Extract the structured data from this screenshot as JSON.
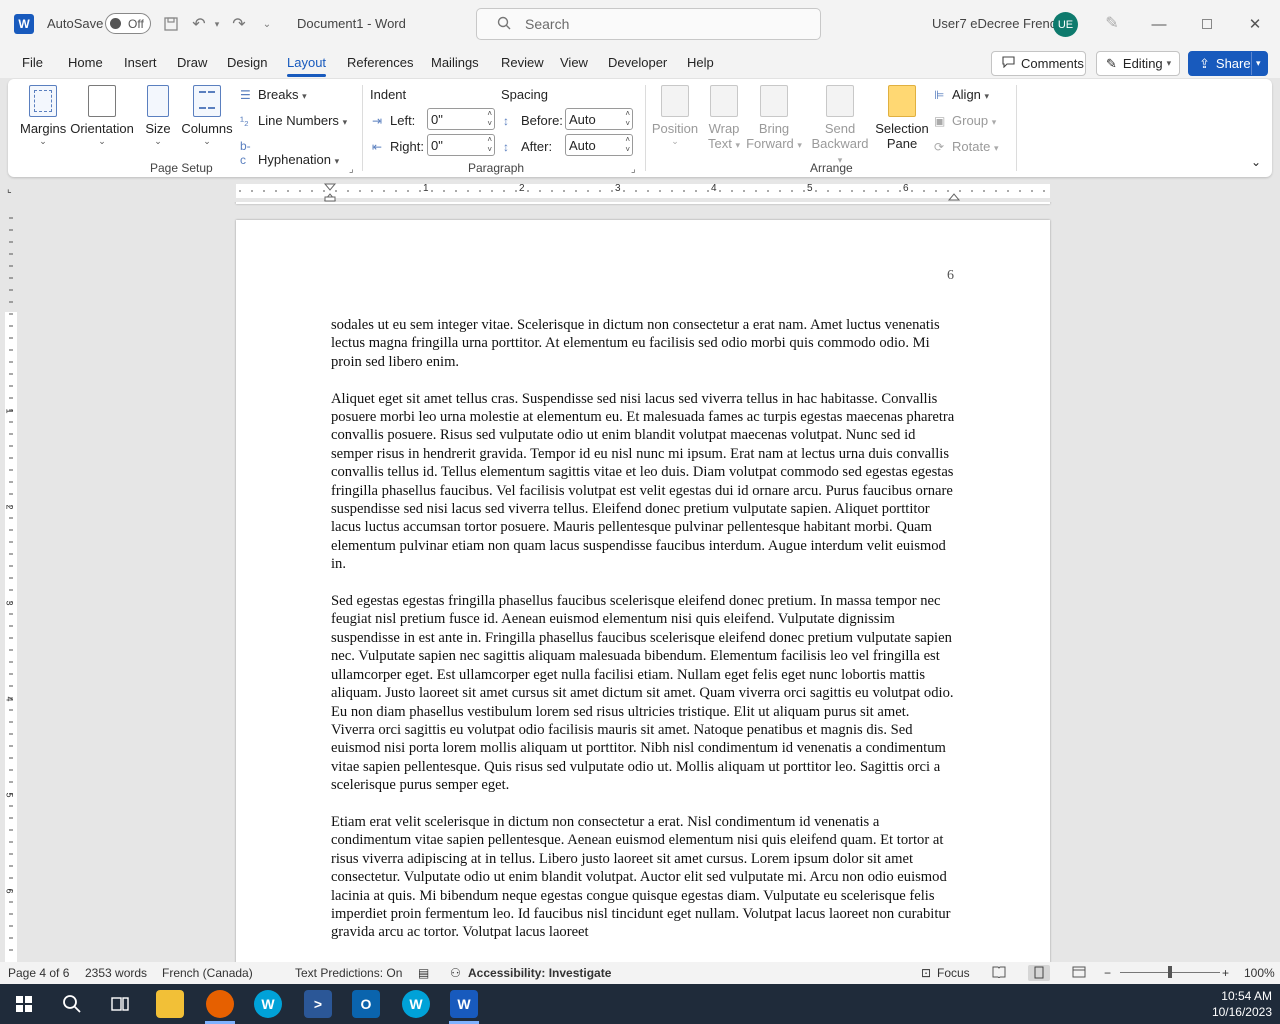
{
  "titlebar": {
    "autosave_label": "AutoSave",
    "autosave_state": "Off",
    "doc_title": "Document1  -  Word",
    "search_placeholder": "Search",
    "user_name": "User7 eDecree French",
    "avatar_initials": "UE"
  },
  "tabs": [
    "File",
    "Home",
    "Insert",
    "Draw",
    "Design",
    "Layout",
    "References",
    "Mailings",
    "Review",
    "View",
    "Developer",
    "Help"
  ],
  "active_tab": "Layout",
  "header_buttons": {
    "comments": "Comments",
    "editing": "Editing",
    "share": "Share"
  },
  "ribbon": {
    "page_setup": {
      "label": "Page Setup",
      "margins": "Margins",
      "orientation": "Orientation",
      "size": "Size",
      "columns": "Columns",
      "breaks": "Breaks",
      "line_numbers": "Line Numbers",
      "hyphenation": "Hyphenation"
    },
    "paragraph": {
      "label": "Paragraph",
      "indent_label": "Indent",
      "spacing_label": "Spacing",
      "left_label": "Left:",
      "left_value": "0\"",
      "right_label": "Right:",
      "right_value": "0\"",
      "before_label": "Before:",
      "before_value": "Auto",
      "after_label": "After:",
      "after_value": "Auto"
    },
    "arrange": {
      "label": "Arrange",
      "position": "Position",
      "wrap_text_1": "Wrap",
      "wrap_text_2": "Text",
      "bring_forward_1": "Bring",
      "bring_forward_2": "Forward",
      "send_backward_1": "Send",
      "send_backward_2": "Backward",
      "selection_pane_1": "Selection",
      "selection_pane_2": "Pane",
      "align": "Align",
      "group": "Group",
      "rotate": "Rotate"
    }
  },
  "ruler": {
    "numbers": [
      "1",
      "2",
      "3",
      "4",
      "5",
      "6"
    ]
  },
  "vruler": {
    "numbers": [
      "1",
      "2",
      "3",
      "4",
      "5",
      "6"
    ]
  },
  "document": {
    "page_number": "6",
    "paragraphs": [
      "sodales ut eu sem integer vitae. Scelerisque in dictum non consectetur a erat nam. Amet luctus venenatis lectus magna fringilla urna porttitor. At elementum eu facilisis sed odio morbi quis commodo odio. Mi proin sed libero enim.",
      "Aliquet eget sit amet tellus cras. Suspendisse sed nisi lacus sed viverra tellus in hac habitasse. Convallis posuere morbi leo urna molestie at elementum eu. Et malesuada fames ac turpis egestas maecenas pharetra convallis posuere. Risus sed vulputate odio ut enim blandit volutpat maecenas volutpat. Nunc sed id semper risus in hendrerit gravida. Tempor id eu nisl nunc mi ipsum. Erat nam at lectus urna duis convallis convallis tellus id. Tellus elementum sagittis vitae et leo duis. Diam volutpat commodo sed egestas egestas fringilla phasellus faucibus. Vel facilisis volutpat est velit egestas dui id ornare arcu. Purus faucibus ornare suspendisse sed nisi lacus sed viverra tellus. Eleifend donec pretium vulputate sapien. Aliquet porttitor lacus luctus accumsan tortor posuere. Mauris pellentesque pulvinar pellentesque habitant morbi. Quam elementum pulvinar etiam non quam lacus suspendisse faucibus interdum. Augue interdum velit euismod in.",
      "Sed egestas egestas fringilla phasellus faucibus scelerisque eleifend donec pretium. In massa tempor nec feugiat nisl pretium fusce id. Aenean euismod elementum nisi quis eleifend. Vulputate dignissim suspendisse in est ante in. Fringilla phasellus faucibus scelerisque eleifend donec pretium vulputate sapien nec. Vulputate sapien nec sagittis aliquam malesuada bibendum. Elementum facilisis leo vel fringilla est ullamcorper eget. Est ullamcorper eget nulla facilisi etiam. Nullam eget felis eget nunc lobortis mattis aliquam. Justo laoreet sit amet cursus sit amet dictum sit amet. Quam viverra orci sagittis eu volutpat odio. Eu non diam phasellus vestibulum lorem sed risus ultricies tristique. Elit ut aliquam purus sit amet. Viverra orci sagittis eu volutpat odio facilisis mauris sit amet. Natoque penatibus et magnis dis. Sed euismod nisi porta lorem mollis aliquam ut porttitor. Nibh nisl condimentum id venenatis a condimentum vitae sapien pellentesque. Quis risus sed vulputate odio ut. Mollis aliquam ut porttitor leo. Sagittis orci a scelerisque purus semper eget.",
      "Etiam erat velit scelerisque in dictum non consectetur a erat. Nisl condimentum id venenatis a condimentum vitae sapien pellentesque. Aenean euismod elementum nisi quis eleifend quam. Et tortor at risus viverra adipiscing at in tellus. Libero justo laoreet sit amet cursus. Lorem ipsum dolor sit amet consectetur. Vulputate odio ut enim blandit volutpat. Auctor elit sed vulputate mi. Arcu non odio euismod lacinia at quis. Mi bibendum neque egestas congue quisque egestas diam. Vulputate eu scelerisque felis imperdiet proin fermentum leo. Id faucibus nisl tincidunt eget nullam. Volutpat lacus laoreet non curabitur gravida arcu ac tortor. Volutpat lacus laoreet"
    ]
  },
  "statusbar": {
    "page": "Page 4 of 6",
    "words": "2353 words",
    "language": "French (Canada)",
    "predictions": "Text Predictions: On",
    "accessibility": "Accessibility: Investigate",
    "focus": "Focus",
    "zoom": "100%",
    "zoom_level": 100
  },
  "taskbar": {
    "time": "10:54 AM",
    "date": "10/16/2023"
  },
  "colors": {
    "accent": "#185abd",
    "ribbon_bg": "#ffffff",
    "chrome_bg": "#f3f3f3",
    "taskbar_bg": "#1f2b3a"
  }
}
